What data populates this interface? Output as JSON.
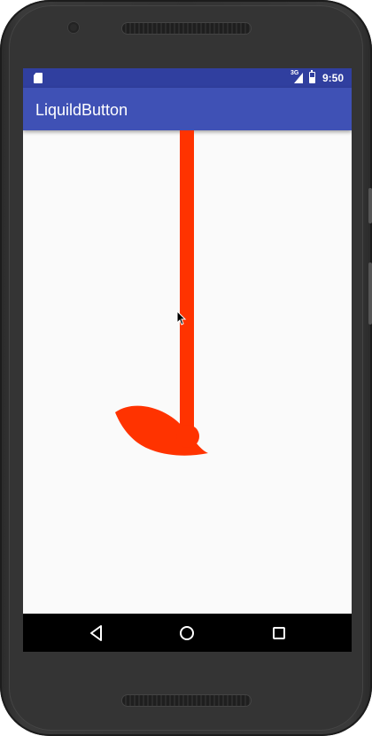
{
  "status_bar": {
    "network_type": "3G",
    "time": "9:50"
  },
  "app_bar": {
    "title": "LiquildButton"
  },
  "liquid_button": {
    "color": "#ff3300"
  },
  "colors": {
    "status_bar": "#303f9f",
    "app_bar": "#3f51b5",
    "screen_bg": "#fafafa",
    "nav_bar": "#000000"
  },
  "nav_bar": {
    "icons": [
      "back-icon",
      "home-icon",
      "recents-icon"
    ]
  }
}
